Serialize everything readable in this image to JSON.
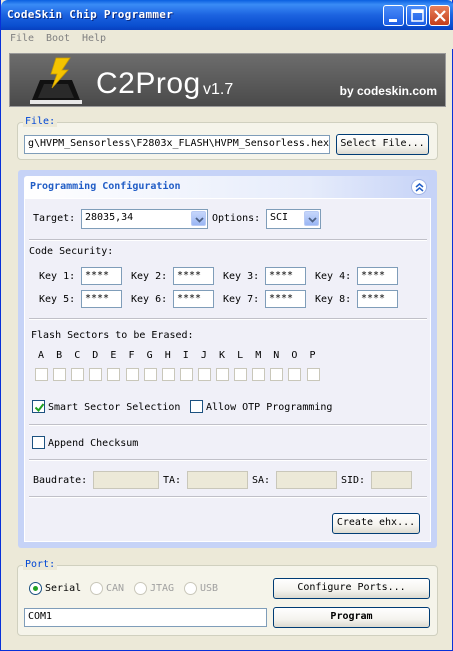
{
  "window": {
    "title": "CodeSkin Chip Programmer"
  },
  "menu": [
    "File",
    "Boot",
    "Help"
  ],
  "banner": {
    "app_name": "C2Prog",
    "version": "v1.7",
    "by": "by codeskin.com"
  },
  "file": {
    "group_label": "File:",
    "path": "g\\HVPM_Sensorless\\F2803x_FLASH\\HVPM_Sensorless.hex",
    "select_button": "Select File..."
  },
  "config": {
    "title": "Programming Configuration",
    "target_label": "Target:",
    "target_value": "28035,34",
    "options_label": "Options:",
    "options_value": "SCI",
    "code_security_label": "Code Security:",
    "keys": [
      {
        "label": "Key 1:",
        "value": "****"
      },
      {
        "label": "Key 2:",
        "value": "****"
      },
      {
        "label": "Key 3:",
        "value": "****"
      },
      {
        "label": "Key 4:",
        "value": "****"
      },
      {
        "label": "Key 5:",
        "value": "****"
      },
      {
        "label": "Key 6:",
        "value": "****"
      },
      {
        "label": "Key 7:",
        "value": "****"
      },
      {
        "label": "Key 8:",
        "value": "****"
      }
    ],
    "flash_sectors_label": "Flash Sectors to be Erased:",
    "sectors": [
      "A",
      "B",
      "C",
      "D",
      "E",
      "F",
      "G",
      "H",
      "I",
      "J",
      "K",
      "L",
      "M",
      "N",
      "O",
      "P"
    ],
    "smart_sector_label": "Smart Sector Selection",
    "smart_sector_checked": true,
    "allow_otp_label": "Allow OTP Programming",
    "allow_otp_checked": false,
    "append_checksum_label": "Append Checksum",
    "append_checksum_checked": false,
    "baudrate_label": "Baudrate:",
    "ta_label": "TA:",
    "sa_label": "SA:",
    "sid_label": "SID:",
    "create_ehx_button": "Create ehx..."
  },
  "port": {
    "group_label": "Port:",
    "options": [
      {
        "label": "Serial",
        "selected": true,
        "enabled": true
      },
      {
        "label": "CAN",
        "selected": false,
        "enabled": false
      },
      {
        "label": "JTAG",
        "selected": false,
        "enabled": false
      },
      {
        "label": "USB",
        "selected": false,
        "enabled": false
      }
    ],
    "configure_button": "Configure Ports...",
    "port_value": "COM1",
    "program_button": "Program"
  },
  "colors": {
    "titlebar": "#0a5fe0",
    "group_label": "#0046d5",
    "config_header_text": "#215dc6",
    "config_panel": "#c6d3f7",
    "check_mark": "#21a121"
  }
}
